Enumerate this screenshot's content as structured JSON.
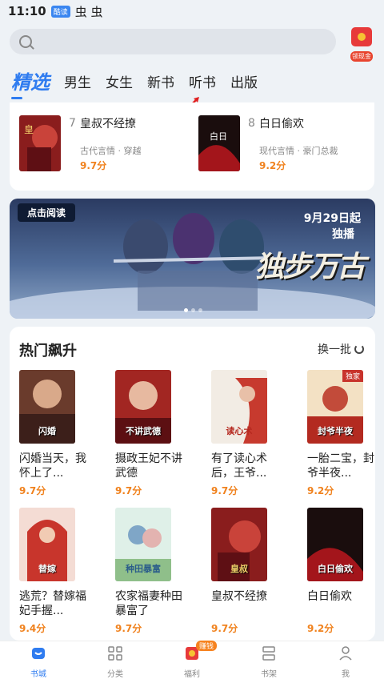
{
  "status": {
    "time": "11:10",
    "app_badge": "酷读",
    "notif": "虫 虫"
  },
  "search": {
    "coin_label": "领现金"
  },
  "tabs": [
    {
      "label": "精选"
    },
    {
      "label": "男生"
    },
    {
      "label": "女生"
    },
    {
      "label": "新书"
    },
    {
      "label": "听书"
    },
    {
      "label": "出版"
    }
  ],
  "ranking": [
    {
      "rank": "7",
      "title": "皇叔不经撩",
      "tags": "古代言情 · 穿越",
      "score": "9.7分"
    },
    {
      "rank": "8",
      "title": "白日偷欢",
      "tags": "现代言情 · 豪门总裁",
      "score": "9.2分"
    }
  ],
  "banner": {
    "tag": "点击阅读",
    "date": "9月29日起",
    "sub": "独播",
    "logo": "独步万古"
  },
  "hot": {
    "title": "热门飙升",
    "refresh_label": "换一批",
    "books": [
      {
        "title": "闪婚当天，我怀上了...",
        "score": "9.7分",
        "cover_text": "闪婚"
      },
      {
        "title": "摄政王妃不讲武德",
        "score": "9.7分",
        "cover_text": "不讲武德"
      },
      {
        "title": "有了读心术后，王爷...",
        "score": "9.7分",
        "cover_text": "读心术"
      },
      {
        "title": "一胎二宝，封爷半夜...",
        "score": "9.2分",
        "cover_text": "封爷半夜",
        "badge": "独家"
      },
      {
        "title": "逃荒？替嫁福妃手握...",
        "score": "9.4分",
        "cover_text": "替嫁"
      },
      {
        "title": "农家福妻种田暴富了",
        "score": "9.7分",
        "cover_text": "种田暴富"
      },
      {
        "title": "皇叔不经撩",
        "score": "9.7分",
        "cover_text": "皇叔"
      },
      {
        "title": "白日偷欢",
        "score": "9.2分",
        "cover_text": "白日偷欢"
      }
    ]
  },
  "nav": [
    {
      "label": "书城"
    },
    {
      "label": "分类"
    },
    {
      "label": "福利",
      "badge": "赚钱"
    },
    {
      "label": "书架"
    },
    {
      "label": "我"
    }
  ]
}
